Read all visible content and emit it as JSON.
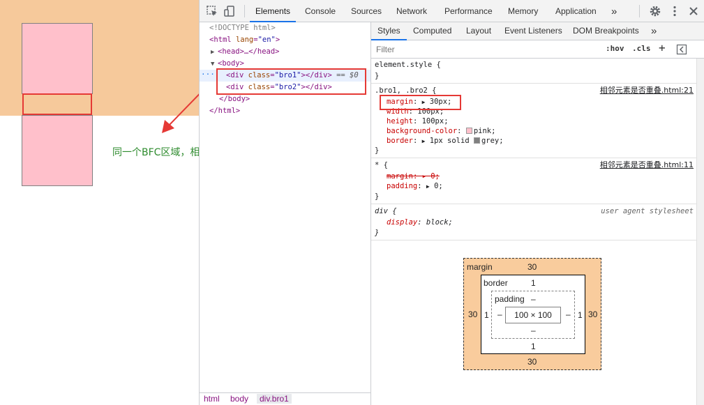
{
  "viewport": {
    "caption": "同一个BFC区域，相邻元素垂直方向外边距重叠",
    "colors": {
      "margin_band": "#f6c99b",
      "box": "#ffc0cb",
      "highlight": "#e53935",
      "caption": "#2e8b2e"
    }
  },
  "toolbar": {
    "tabs": [
      "Elements",
      "Console",
      "Sources",
      "Network",
      "Performance",
      "Memory",
      "Application"
    ],
    "more": "»",
    "icons": [
      "inspect-icon",
      "device-toggle-icon",
      "gear-icon",
      "kebab-menu-icon",
      "close-icon"
    ]
  },
  "dom": {
    "doctype": "<!DOCTYPE html>",
    "html_open": {
      "tag": "html",
      "attr": "lang",
      "val": "\"en\""
    },
    "head": "<head>…</head>",
    "body_open": "<body>",
    "div1": {
      "tag": "div",
      "attr": "class",
      "val": "\"bro1\"",
      "suffix": " == $0"
    },
    "div2": {
      "tag": "div",
      "attr": "class",
      "val": "\"bro2\""
    },
    "body_close": "</body>",
    "html_close": "</html>",
    "dots": "···"
  },
  "breadcrumbs": [
    "html",
    "body",
    "div.bro1"
  ],
  "styles": {
    "subtabs": [
      "Styles",
      "Computed",
      "Layout",
      "Event Listeners",
      "DOM Breakpoints"
    ],
    "more": "»",
    "filter_placeholder": "Filter",
    "hov": ":hov",
    "cls": ".cls",
    "plus": "+",
    "element_style": {
      "selector": "element.style {",
      "close": "}"
    },
    "rule1": {
      "selector": ".bro1, .bro2 {",
      "source": "相邻元素是否重叠.html:21",
      "props": [
        {
          "name": "margin",
          "value": "30px;"
        },
        {
          "name": "width",
          "value": "100px;"
        },
        {
          "name": "height",
          "value": "100px;"
        },
        {
          "name": "background-color",
          "value": "pink;",
          "swatch": "#ffc0cb"
        },
        {
          "name": "border",
          "value": "1px solid ",
          "value2": "grey;",
          "swatch": "#808080"
        }
      ],
      "close": "}"
    },
    "rule2": {
      "selector": "* {",
      "source": "相邻元素是否重叠.html:11",
      "props": [
        {
          "name": "margin",
          "value": "0;"
        },
        {
          "name": "padding",
          "value": "0;"
        }
      ],
      "close": "}"
    },
    "rule3": {
      "selector": "div {",
      "source": "user agent stylesheet",
      "props": [
        {
          "name": "display",
          "value": "block;"
        }
      ],
      "close": "}"
    }
  },
  "boxmodel": {
    "margin_label": "margin",
    "margin_top": "30",
    "margin_left": "30",
    "margin_right": "30",
    "margin_bottom": "30",
    "border_label": "border",
    "border_top": "1",
    "border_left": "1",
    "border_right": "1",
    "border_bottom": "1",
    "padding_label": "padding",
    "padding_top": "–",
    "padding_left": "–",
    "padding_right": "–",
    "padding_bottom": "–",
    "content": "100 × 100"
  }
}
